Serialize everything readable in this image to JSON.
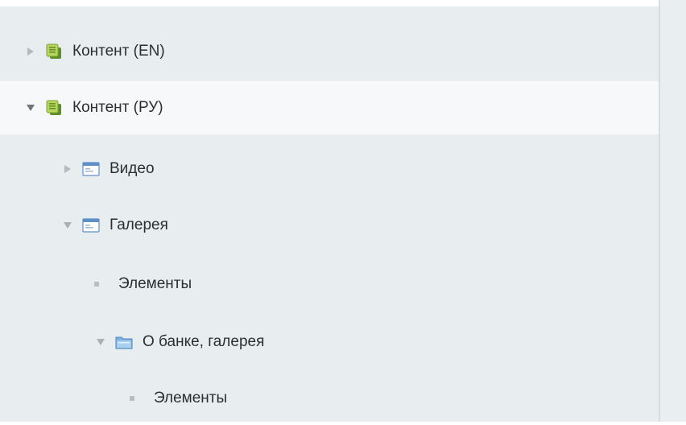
{
  "tree": {
    "items": [
      {
        "label": "Контент (EN)",
        "expanded": false,
        "icon": "content-iblock-icon",
        "level": 0,
        "selected": false
      },
      {
        "label": "Контент (РУ)",
        "expanded": true,
        "icon": "content-iblock-icon",
        "level": 0,
        "selected": true
      },
      {
        "label": "Видео",
        "expanded": false,
        "icon": "iblock-window-icon",
        "level": 1,
        "selected": false
      },
      {
        "label": "Галерея",
        "expanded": true,
        "icon": "iblock-window-icon",
        "level": 1,
        "selected": false
      },
      {
        "label": "Элементы",
        "icon": "bullet-icon",
        "level": 2,
        "selected": false
      },
      {
        "label": "О банке, галерея",
        "expanded": true,
        "icon": "folder-icon",
        "level": 2,
        "selected": false
      },
      {
        "label": "Элементы",
        "icon": "bullet-icon",
        "level": 3,
        "selected": false
      }
    ]
  },
  "colors": {
    "panel_bg": "#e8edf0",
    "selected_row_bg": "#f7f8f9",
    "text": "#2a2f33",
    "arrow": "#8e969c",
    "bullet": "#b6bec4",
    "divider": "#d6dde2"
  }
}
